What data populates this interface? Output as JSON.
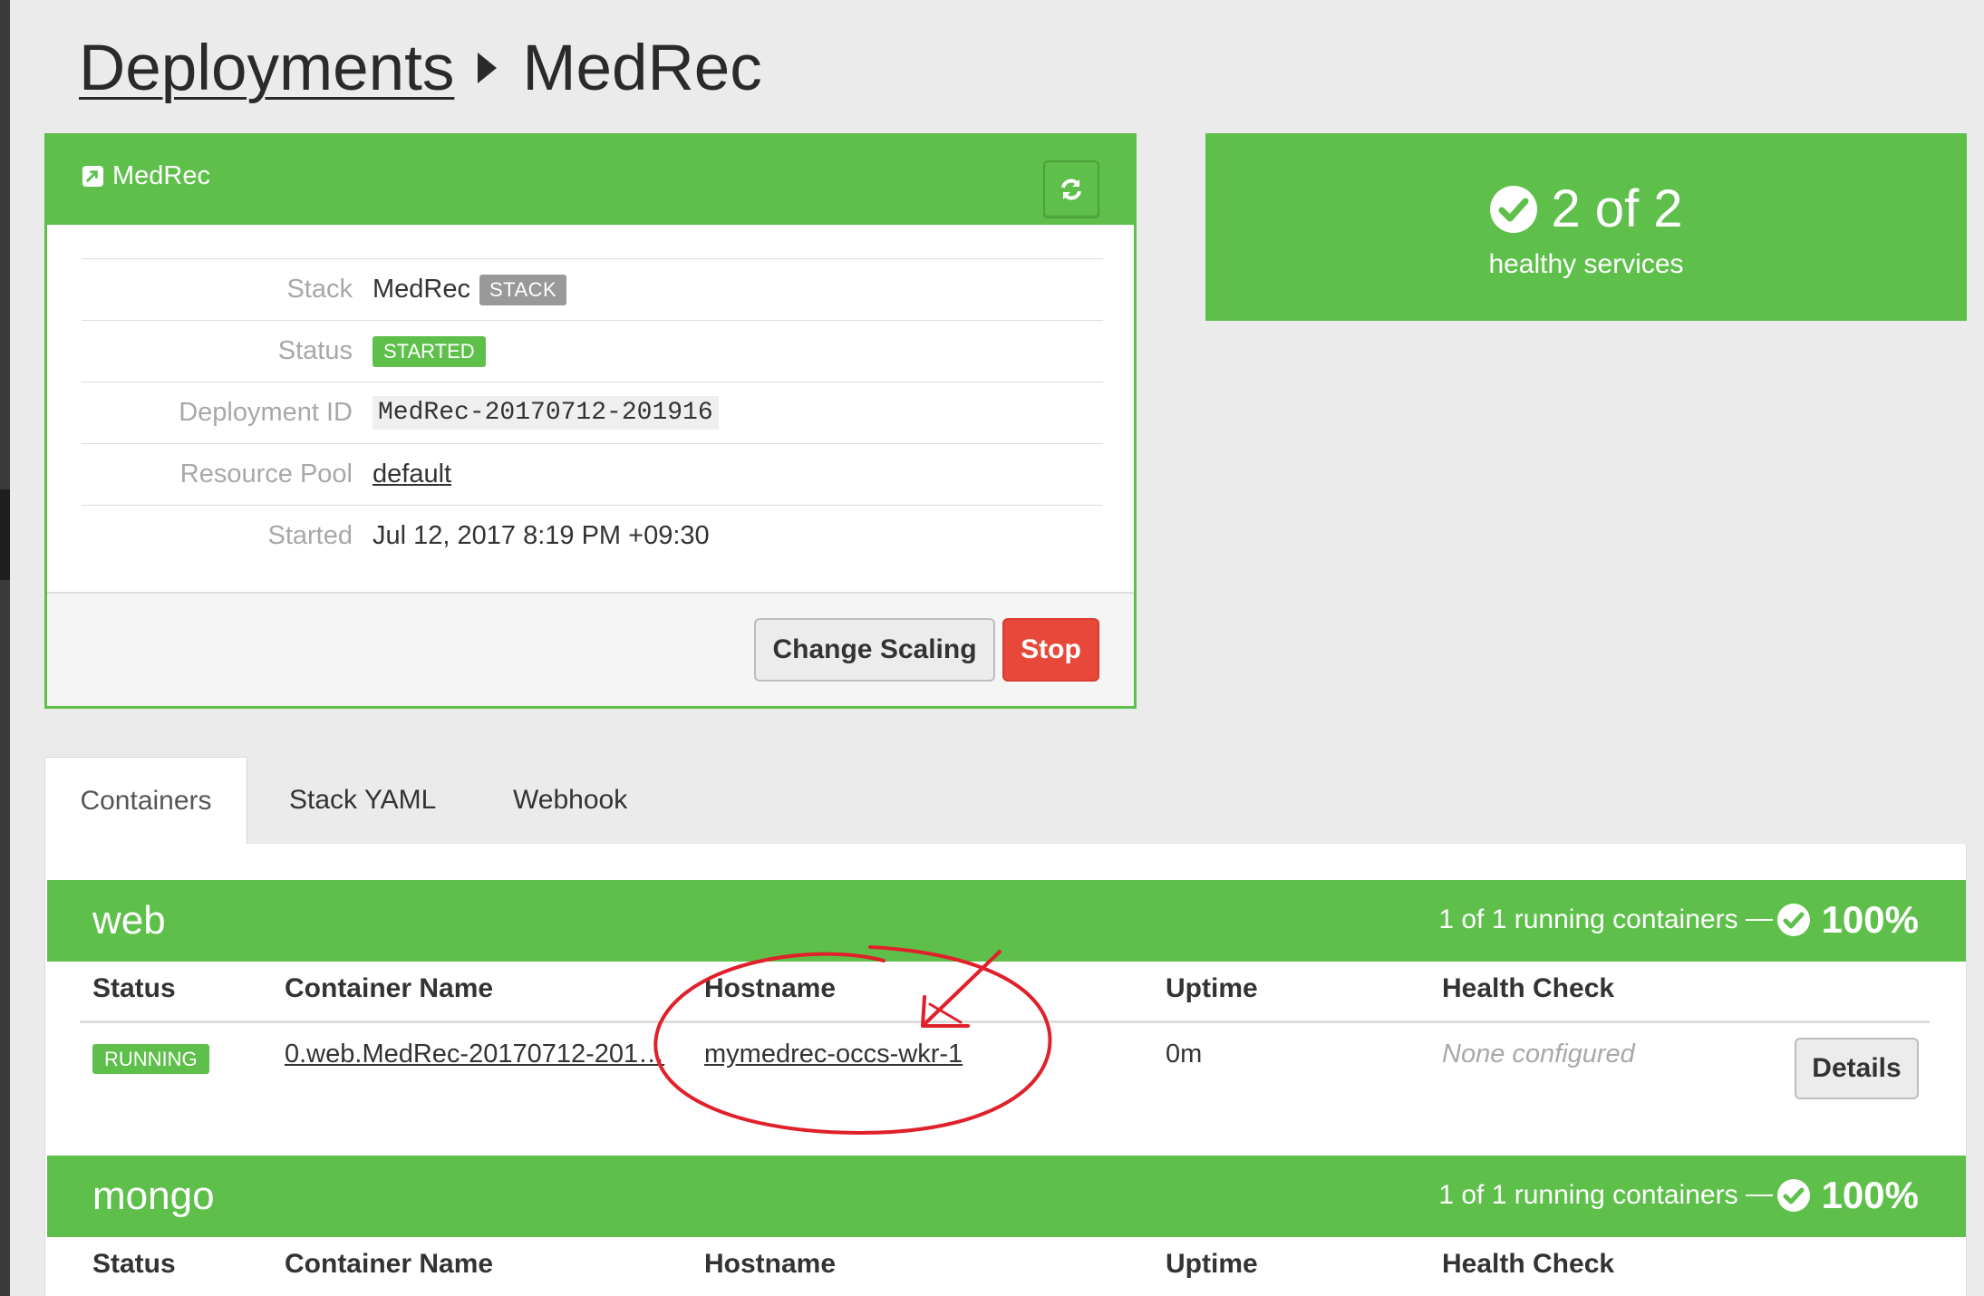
{
  "breadcrumb": {
    "parent": "Deployments",
    "current": "MedRec"
  },
  "panel": {
    "title": "MedRec",
    "rows": [
      {
        "label": "Stack",
        "value": "MedRec",
        "badge": "STACK"
      },
      {
        "label": "Status",
        "badge": "STARTED"
      },
      {
        "label": "Deployment ID",
        "value": "MedRec-20170712-201916"
      },
      {
        "label": "Resource Pool",
        "value": "default"
      },
      {
        "label": "Started",
        "value": "Jul 12, 2017 8:19 PM +09:30"
      }
    ],
    "buttons": {
      "change_scaling": "Change Scaling",
      "stop": "Stop"
    }
  },
  "health": {
    "count": "2 of 2",
    "label": "healthy services"
  },
  "tabs": [
    "Containers",
    "Stack YAML",
    "Webhook"
  ],
  "columns": [
    "Status",
    "Container Name",
    "Hostname",
    "Uptime",
    "Health Check"
  ],
  "services": [
    {
      "name": "web",
      "running": "1 of 1 running containers",
      "percent": "100%",
      "rows": [
        {
          "status": "RUNNING",
          "container": "0.web.MedRec-20170712-201…",
          "hostname": "mymedrec-occs-wkr-1",
          "uptime": "0m",
          "health": "None configured",
          "details": "Details"
        }
      ]
    },
    {
      "name": "mongo",
      "running": "1 of 1 running containers",
      "percent": "100%",
      "rows": []
    }
  ],
  "colors": {
    "green": "#5ec04b",
    "red": "#e8483a",
    "annotation": "#e0202a"
  }
}
